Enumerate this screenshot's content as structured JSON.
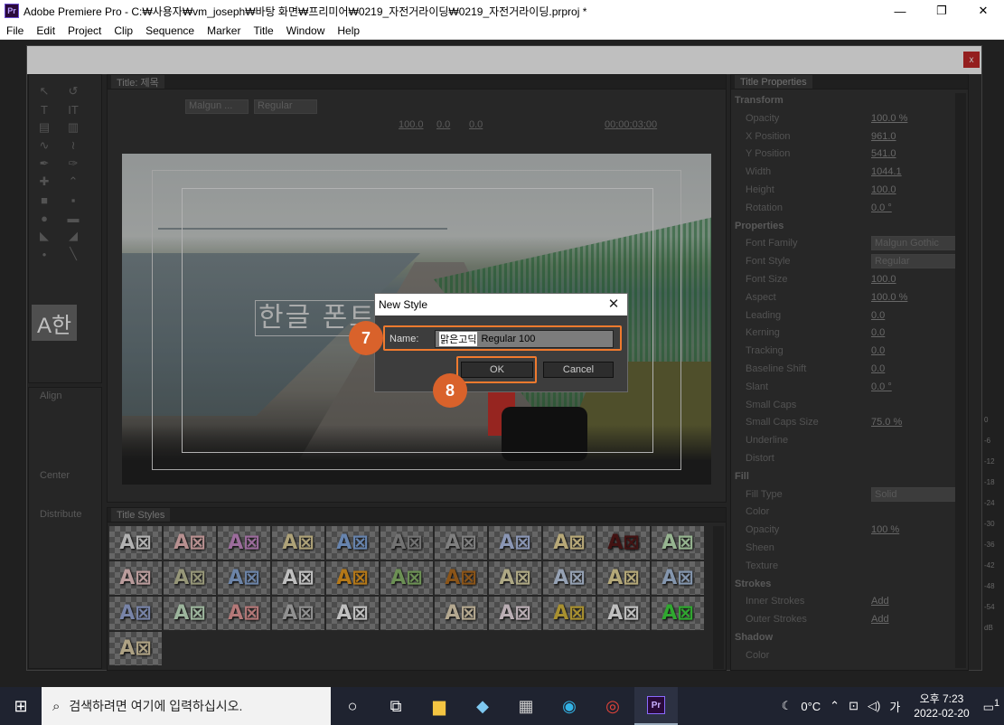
{
  "app": {
    "icon_text": "Pr",
    "title": "Adobe Premiere Pro - C:₩사용자₩vm_joseph₩바탕 화면₩프리미어₩0219_자전거라이딩₩0219_자전거라이딩.prproj *",
    "window_controls": [
      "—",
      "❐",
      "✕"
    ]
  },
  "menu": [
    "File",
    "Edit",
    "Project",
    "Clip",
    "Sequence",
    "Marker",
    "Title",
    "Window",
    "Help"
  ],
  "designer": {
    "close_label": "x",
    "title_tab": "Title: 제목",
    "toolbar": {
      "font_family": "Malgun ...",
      "font_style": "Regular",
      "values": [
        "100.0",
        "0.0",
        "0.0"
      ],
      "timecode": "00;00;03;00"
    },
    "tools_font_preview": "A한",
    "align_labels": [
      "Align",
      "Center",
      "Distribute"
    ],
    "canvas_text": "한글 폰트",
    "styles_tab": "Title Styles",
    "style_swatches": [
      "A⊠",
      "A⊠",
      "A⊠",
      "A⊠",
      "A⊠",
      "A⊠",
      "A⊠",
      "A⊠",
      "A⊠",
      "A⊠",
      "A⊠",
      "A⊠",
      "A⊠",
      "A⊠",
      "A⊠",
      "A⊠",
      "A⊠",
      "A⊠",
      "A⊠",
      "A⊠",
      "A⊠",
      "A⊠",
      "A⊠",
      "A⊠",
      "A⊠",
      "A⊠",
      "A⊠",
      "",
      "A⊠",
      "A⊠",
      "A⊠",
      "A⊠",
      "A⊠",
      "A⊠"
    ],
    "swatch_colors": [
      "#eee",
      "#f4c0c0",
      "#d090d0",
      "#e8d8a0",
      "#8ab0e8",
      "#999",
      "#aaa",
      "#b8c8f0",
      "#f4e0a0",
      "#5a1a1a",
      "#c8f0c0",
      "#f8d0d0",
      "#c8c8a0",
      "#90b0e0",
      "#fff",
      "#f0a020",
      "#90c070",
      "#b87020",
      "#e8e0b0",
      "#c8d8f0",
      "#f0e0a0",
      "#b0c8e8",
      "#a0b0e0",
      "#d0f0d0",
      "#f0a0a0",
      "#c0c0c0",
      "#fff",
      "#888",
      "#f0e0c0",
      "#f8e8f0",
      "#e0c040",
      "#fff",
      "#40e040",
      "#e8d8b0"
    ],
    "properties_tab": "Title Properties",
    "properties": [
      {
        "type": "head",
        "label": "Transform"
      },
      {
        "type": "row",
        "label": "Opacity",
        "value": "100.0 %"
      },
      {
        "type": "row",
        "label": "X Position",
        "value": "961.0"
      },
      {
        "type": "row",
        "label": "Y Position",
        "value": "541.0"
      },
      {
        "type": "row",
        "label": "Width",
        "value": "1044.1"
      },
      {
        "type": "row",
        "label": "Height",
        "value": "100.0"
      },
      {
        "type": "row",
        "label": "Rotation",
        "value": "0.0 °"
      },
      {
        "type": "head",
        "label": "Properties"
      },
      {
        "type": "select",
        "label": "Font Family",
        "value": "Malgun Gothic"
      },
      {
        "type": "select",
        "label": "Font Style",
        "value": "Regular"
      },
      {
        "type": "row",
        "label": "Font Size",
        "value": "100.0"
      },
      {
        "type": "row",
        "label": "Aspect",
        "value": "100.0 %"
      },
      {
        "type": "row",
        "label": "Leading",
        "value": "0.0"
      },
      {
        "type": "row",
        "label": "Kerning",
        "value": "0.0"
      },
      {
        "type": "row",
        "label": "Tracking",
        "value": "0.0"
      },
      {
        "type": "row",
        "label": "Baseline Shift",
        "value": "0.0"
      },
      {
        "type": "row",
        "label": "Slant",
        "value": "0.0 °"
      },
      {
        "type": "row",
        "label": "Small Caps",
        "value": ""
      },
      {
        "type": "row",
        "label": "Small Caps Size",
        "value": "75.0 %"
      },
      {
        "type": "row",
        "label": "Underline",
        "value": ""
      },
      {
        "type": "row",
        "label": "Distort",
        "value": ""
      },
      {
        "type": "head",
        "label": "Fill"
      },
      {
        "type": "select",
        "label": "Fill Type",
        "value": "Solid"
      },
      {
        "type": "row",
        "label": "Color",
        "value": ""
      },
      {
        "type": "row",
        "label": "Opacity",
        "value": "100 %"
      },
      {
        "type": "row",
        "label": "Sheen",
        "value": ""
      },
      {
        "type": "row",
        "label": "Texture",
        "value": ""
      },
      {
        "type": "head",
        "label": "Strokes"
      },
      {
        "type": "row",
        "label": "Inner Strokes",
        "value": "Add"
      },
      {
        "type": "row",
        "label": "Outer Strokes",
        "value": "Add"
      },
      {
        "type": "head",
        "label": "Shadow"
      },
      {
        "type": "row",
        "label": "Color",
        "value": ""
      }
    ],
    "meter_ticks": [
      "0",
      "-6",
      "-12",
      "-18",
      "-24",
      "-30",
      "-36",
      "-42",
      "-48",
      "-54",
      "dB"
    ]
  },
  "dialog": {
    "title": "New Style",
    "close": "✕",
    "name_label": "Name:",
    "name_value_highlight": "맑은고딕",
    "name_value_rest": "Regular 100",
    "ok_label": "OK",
    "cancel_label": "Cancel"
  },
  "annotations": {
    "step_7": "7",
    "step_8": "8"
  },
  "taskbar": {
    "search_placeholder": "검색하려면 여기에 입력하십시오.",
    "weather": "0°C",
    "ime": "가",
    "time": "오후 7:23",
    "date": "2022-02-20",
    "notification_count": "1"
  }
}
